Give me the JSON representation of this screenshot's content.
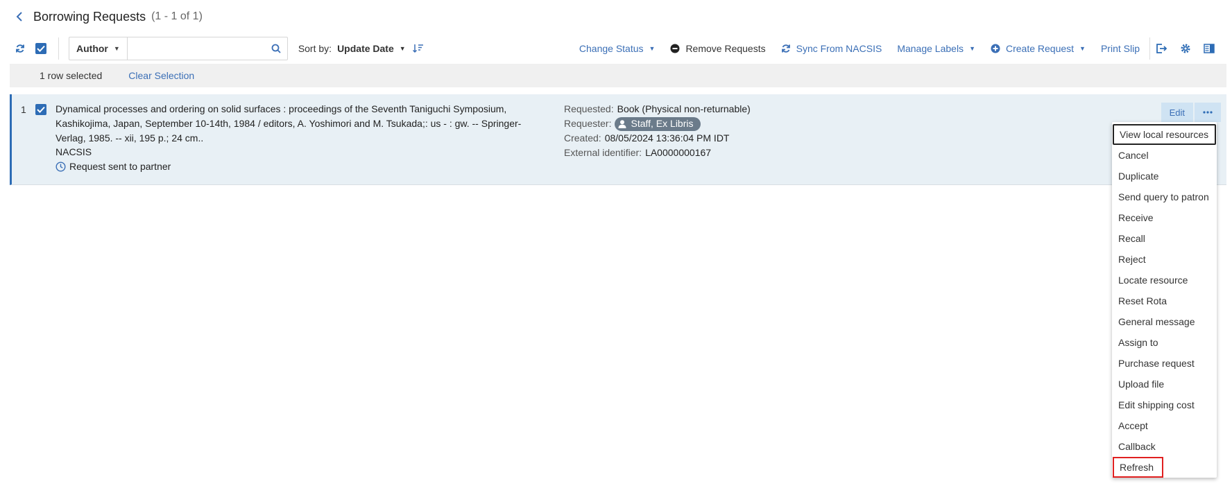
{
  "header": {
    "title": "Borrowing Requests",
    "count": "(1 - 1 of 1)"
  },
  "toolbar": {
    "search_field": "Author",
    "search_value": "",
    "sort_label": "Sort by:",
    "sort_value": "Update Date",
    "actions": [
      {
        "label": "Change Status",
        "icon": "",
        "caret": true,
        "style": "link"
      },
      {
        "label": "Remove Requests",
        "icon": "minus-circle-icon",
        "caret": false,
        "style": "dark"
      },
      {
        "label": "Sync From NACSIS",
        "icon": "sync-icon",
        "caret": false,
        "style": "link"
      },
      {
        "label": "Manage Labels",
        "icon": "",
        "caret": true,
        "style": "link"
      },
      {
        "label": "Create Request",
        "icon": "plus-circle-icon",
        "caret": true,
        "style": "link"
      },
      {
        "label": "Print Slip",
        "icon": "",
        "caret": false,
        "style": "link"
      }
    ]
  },
  "selection": {
    "count_text": "1 row selected",
    "clear_label": "Clear Selection"
  },
  "rows": [
    {
      "number": "1",
      "title": "Dynamical processes and ordering on solid surfaces : proceedings of the Seventh Taniguchi Symposium, Kashikojima, Japan, September 10-14th, 1984 / editors, A. Yoshimori and M. Tsukada;: us - : gw. -- Springer-Verlag, 1985. -- xii, 195 p.; 24 cm..",
      "source": "NACSIS",
      "status": "Request sent to partner",
      "requested_label": "Requested:",
      "requested_value": "Book (Physical non-returnable)",
      "requester_label": "Requester:",
      "requester_value": "Staff, Ex Libris",
      "created_label": "Created:",
      "created_value": "08/05/2024 13:36:04 PM IDT",
      "external_label": "External identifier:",
      "external_value": "LA0000000167",
      "edit_label": "Edit"
    }
  ],
  "menu": {
    "items": [
      "View local resources",
      "Cancel",
      "Duplicate",
      "Send query to patron",
      "Receive",
      "Recall",
      "Reject",
      "Locate resource",
      "Reset Rota",
      "General message",
      "Assign to",
      "Purchase request",
      "Upload file",
      "Edit shipping cost",
      "Accept",
      "Callback",
      "Refresh"
    ],
    "focused_item": "View local resources",
    "highlighted_item": "Refresh"
  },
  "colors": {
    "accent": "#3b6fb6",
    "checkbox": "#2d6cb5",
    "row_bg": "#e8f0f5",
    "highlight_border": "#e02020"
  }
}
